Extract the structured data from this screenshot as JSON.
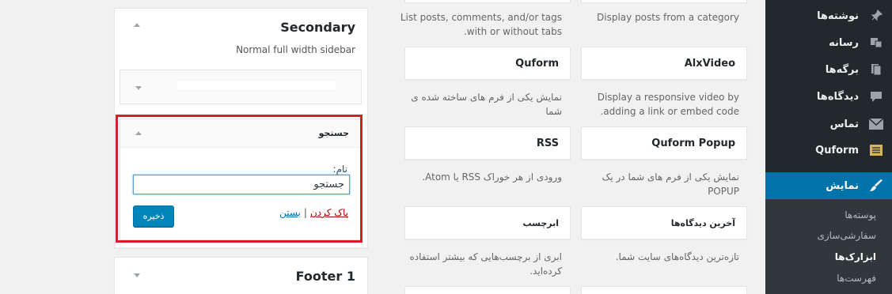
{
  "admin_menu": {
    "items": [
      {
        "label": "نوشته‌ها",
        "icon": "pin-icon"
      },
      {
        "label": "رسانه",
        "icon": "media-icon"
      },
      {
        "label": "برگه‌ها",
        "icon": "pages-icon"
      },
      {
        "label": "دیدگاه‌ها",
        "icon": "comments-icon"
      },
      {
        "label": "تماس",
        "icon": "mail-icon"
      },
      {
        "label": "Quform",
        "icon": "quform-icon"
      },
      {
        "label": "نمایش",
        "icon": "appearance-icon"
      }
    ],
    "submenu": [
      "پوسته‌ها",
      "سفارشی‌سازی",
      "ابزارک‌ها",
      "فهرست‌ها"
    ]
  },
  "available_widgets": {
    "top_right_desc": "Display posts from a category",
    "top_left_desc": "List posts, comments, and/or tags with or without tabs.",
    "cards": [
      {
        "title": "AlxVideo",
        "desc": "Display a responsive video by adding a link or embed code."
      },
      {
        "title": "Quform",
        "desc": "نمایش یکی از فرم های ساخته شده ی شما"
      },
      {
        "title": "Quform Popup",
        "desc": "نمایش یکی از فرم های شما در یک POPUP"
      },
      {
        "title": "RSS",
        "desc": "ورودی از هر خوراک RSS یا Atom."
      },
      {
        "title": "آخرین دیدگاه‌ها",
        "desc": "تازه‌ترین دیدگاه‌های سایت شما."
      },
      {
        "title": "ابرچسب",
        "desc": "ابری از برچسب‌هایی که بیشتر استفاده کرده‌اید."
      }
    ]
  },
  "sidebars": {
    "secondary": {
      "title": "Secondary",
      "description": "Normal full width sidebar"
    },
    "search_widget": {
      "title": "جستجو",
      "field_label": "نام:",
      "field_value": "جستجو",
      "save_label": "ذخیره",
      "delete_label": "پاک کردن",
      "separator": "|",
      "close_label": "بستن"
    },
    "footer": {
      "title": "Footer 1"
    }
  },
  "colors": {
    "admin_bg": "#23282d",
    "admin_current": "#0073aa",
    "highlight": "#d21f2a",
    "button": "#0085ba"
  }
}
